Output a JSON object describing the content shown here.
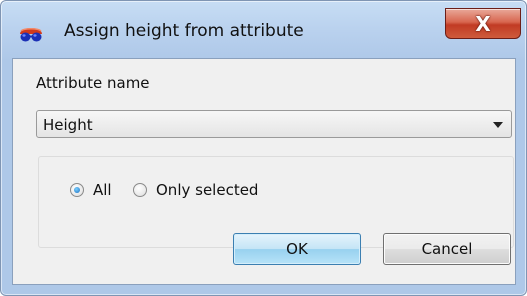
{
  "window": {
    "title": "Assign height from attribute",
    "app_icon": "red-blue-3d-glasses-icon",
    "close_glyph": "X"
  },
  "form": {
    "attribute_label": "Attribute name",
    "attribute_select": {
      "value": "Height"
    },
    "selection_mode": {
      "options": [
        {
          "label": "All",
          "checked": true
        },
        {
          "label": "Only selected",
          "checked": false
        }
      ]
    }
  },
  "buttons": {
    "ok": "OK",
    "cancel": "Cancel"
  },
  "colors": {
    "titlebar": "#b9d1ee",
    "close_button": "#c13b24",
    "default_button_border": "#3c7fb1",
    "radio_selected": "#1d6fc0"
  }
}
